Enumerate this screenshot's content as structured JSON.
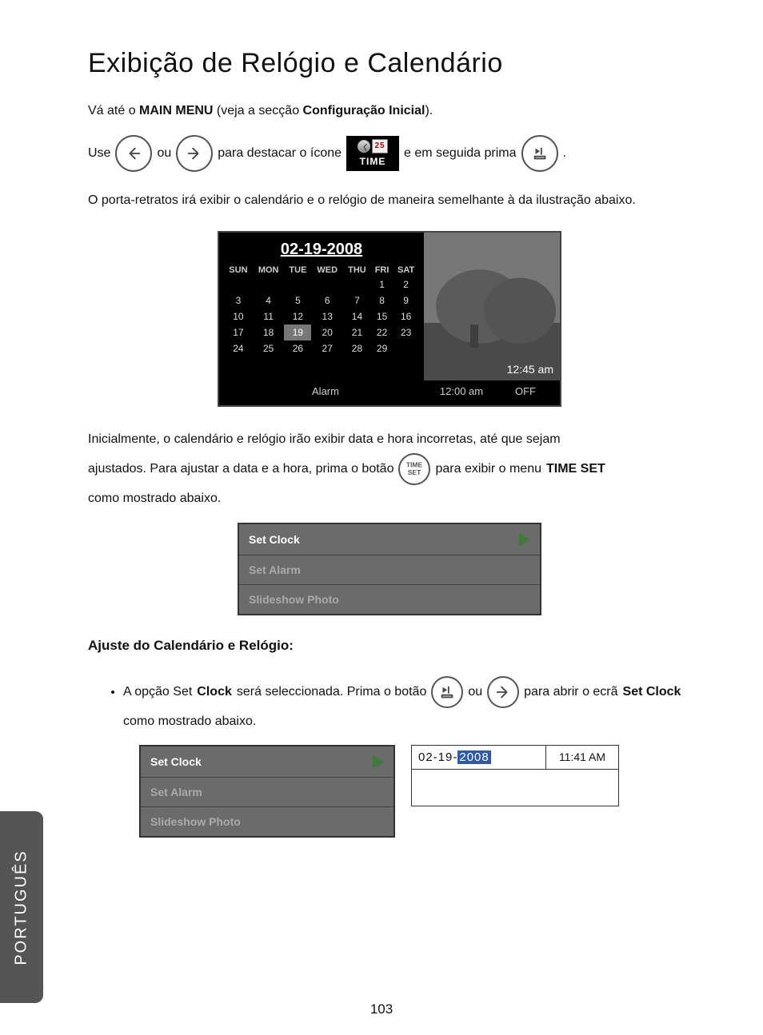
{
  "title": "Exibição de Relógio e Calendário",
  "intro_pre": "Vá até o ",
  "intro_b1": "MAIN MENU",
  "intro_mid": " (veja a secção ",
  "intro_b2": "Configuração Inicial",
  "intro_post": ").",
  "line2": {
    "use": "Use ",
    "ou": " ou ",
    "mid": " para destacar o ícone ",
    "after_icon": " e em seguida prima ",
    "end": "."
  },
  "time_icon": {
    "day": "25",
    "label": "TIME"
  },
  "para3": "O porta-retratos irá exibir o calendário e o relógio de maneira semelhante à da ilustração abaixo.",
  "calendar": {
    "date": "02-19-2008",
    "dow": [
      "SUN",
      "MON",
      "TUE",
      "WED",
      "THU",
      "FRI",
      "SAT"
    ],
    "rows": [
      [
        "",
        "",
        "",
        "",
        "",
        "1",
        "2"
      ],
      [
        "3",
        "4",
        "5",
        "6",
        "7",
        "8",
        "9"
      ],
      [
        "10",
        "11",
        "12",
        "13",
        "14",
        "15",
        "16"
      ],
      [
        "17",
        "18",
        "19",
        "20",
        "21",
        "22",
        "23"
      ],
      [
        "24",
        "25",
        "26",
        "27",
        "28",
        "29",
        ""
      ]
    ],
    "highlight": "19",
    "clock": "12:45 am",
    "alarm_label": "Alarm",
    "alarm_time": "12:00 am",
    "alarm_state": "OFF"
  },
  "para4_a": "Inicialmente, o calendário e relógio irão exibir data e hora incorretas, até que sejam ",
  "para4_b": "ajustados.  Para ajustar a data e a hora, prima o botão ",
  "para4_c": " para exibir o menu ",
  "para4_bold": "TIME SET",
  "para4_d": " como mostrado abaixo.",
  "timeset_btn": "TIME SET",
  "menu1": {
    "r1": "Set Clock",
    "r2": "Set Alarm",
    "r3": "Slideshow Photo"
  },
  "subhead": "Ajuste do Calendário e Relógio:",
  "bullet": {
    "a": "A opção Set ",
    "b1": "Clock",
    "b": " será seleccionada. Prima o botão ",
    "ou": " ou ",
    "c": " para abrir o ecrã ",
    "b2": "Set Clock",
    "d": " como mostrado abaixo."
  },
  "menu2": {
    "r1": "Set Clock",
    "r2": "Set Alarm",
    "r3": "Slideshow Photo"
  },
  "clock_panel": {
    "date_pre": "02-19-",
    "date_sel": "2008",
    "time": "11:41 AM"
  },
  "lang_tab": "PORTUGUÊS",
  "page_num": "103"
}
